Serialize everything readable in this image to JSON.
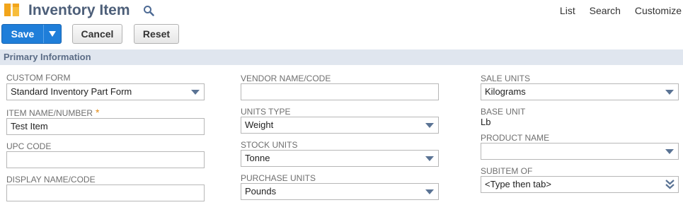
{
  "header": {
    "title": "Inventory Item",
    "links": [
      "List",
      "Search",
      "Customize"
    ]
  },
  "toolbar": {
    "save_label": "Save",
    "cancel_label": "Cancel",
    "reset_label": "Reset"
  },
  "section": {
    "title": "Primary Information"
  },
  "fields": {
    "custom_form": {
      "label": "CUSTOM FORM",
      "value": "Standard Inventory Part Form"
    },
    "item_name": {
      "label": "ITEM NAME/NUMBER",
      "required_mark": "*",
      "value": "Test Item"
    },
    "upc_code": {
      "label": "UPC CODE",
      "value": ""
    },
    "display_name": {
      "label": "DISPLAY NAME/CODE",
      "value": ""
    },
    "vendor_name": {
      "label": "VENDOR NAME/CODE",
      "value": ""
    },
    "units_type": {
      "label": "UNITS TYPE",
      "value": "Weight"
    },
    "stock_units": {
      "label": "STOCK UNITS",
      "value": "Tonne"
    },
    "purchase_units": {
      "label": "PURCHASE UNITS",
      "value": "Pounds"
    },
    "sale_units": {
      "label": "SALE UNITS",
      "value": "Kilograms"
    },
    "base_unit": {
      "label": "BASE UNIT",
      "value": "Lb"
    },
    "product_name": {
      "label": "PRODUCT NAME",
      "value": ""
    },
    "subitem_of": {
      "label": "SUBITEM OF",
      "value": "<Type then tab>"
    }
  },
  "colors": {
    "accent": "#1f7ed9",
    "title": "#4d5f79",
    "section_bar": "#e0e6ef",
    "required": "#e38a13"
  },
  "icons": [
    "inventory-item-icon",
    "search-icon",
    "dropdown-arrow-icon",
    "caret-down-icon",
    "double-chevron-down-icon"
  ]
}
